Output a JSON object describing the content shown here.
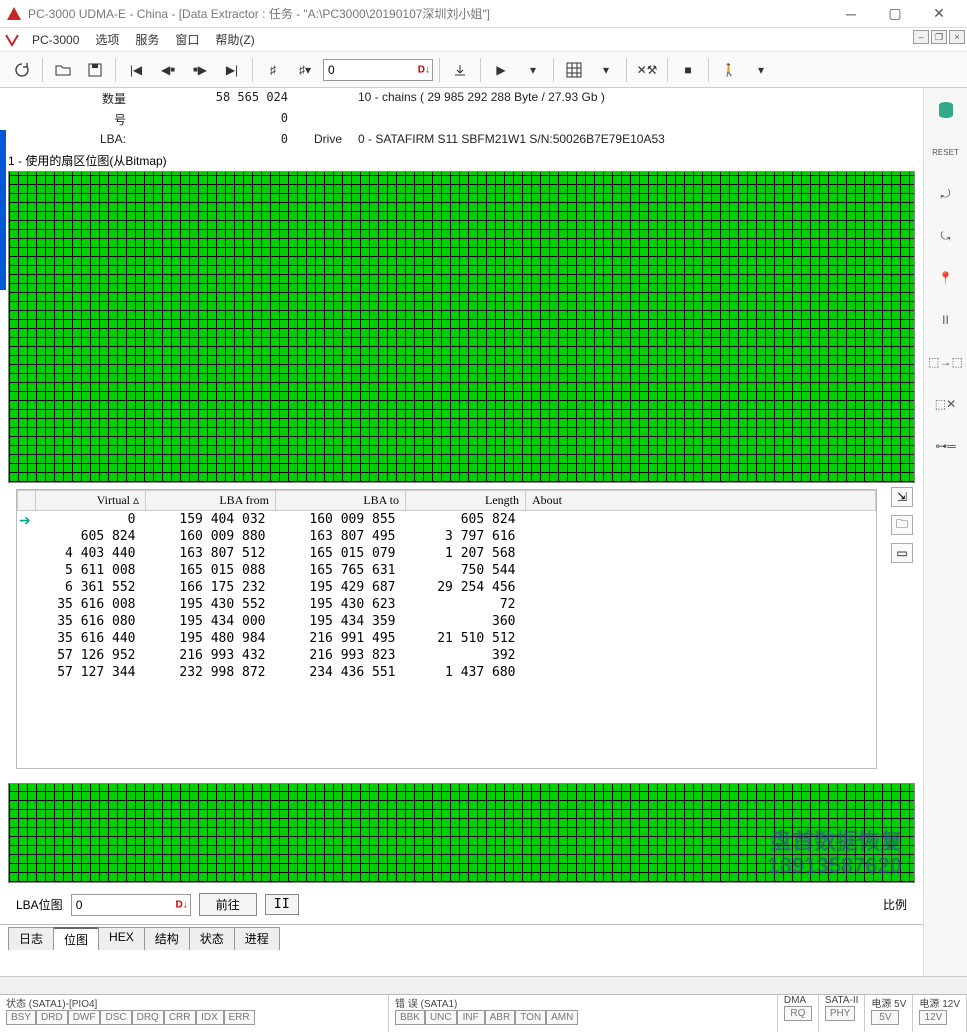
{
  "window": {
    "title": "PC-3000 UDMA-E - China - [Data Extractor : 任务 - \"A:\\PC3000\\20190107深圳刘小姐\"]",
    "app": "PC-3000"
  },
  "menu": {
    "items": [
      "选项",
      "服务",
      "窗口",
      "帮助(Z)"
    ]
  },
  "toolbar_input": {
    "value": "0"
  },
  "info": {
    "qty_label": "数量",
    "qty_value": "58 565 024",
    "qty_extra": "10 - chains   ( 29 985 292 288 Byte /   27.93 Gb )",
    "num_label": "号",
    "num_value": "0",
    "lba_label": "LBA:",
    "lba_value": "0",
    "drive_label": "Drive",
    "drive_value": "0 - SATAFIRM   S11 SBFM21W1 S/N:50026B7E79E10A53"
  },
  "bitmap_panel_label": "1 - 使用的扇区位图(从Bitmap)",
  "table": {
    "headers": {
      "virtual": "Virtual ▵",
      "lba_from": "LBA from",
      "lba_to": "LBA to",
      "length": "Length",
      "about": "About"
    },
    "rows": [
      {
        "virtual": "0",
        "from": "159 404 032",
        "to": "160 009 855",
        "len": "605 824",
        "about": ""
      },
      {
        "virtual": "605 824",
        "from": "160 009 880",
        "to": "163 807 495",
        "len": "3 797 616",
        "about": ""
      },
      {
        "virtual": "4 403 440",
        "from": "163 807 512",
        "to": "165 015 079",
        "len": "1 207 568",
        "about": ""
      },
      {
        "virtual": "5 611 008",
        "from": "165 015 088",
        "to": "165 765 631",
        "len": "750 544",
        "about": ""
      },
      {
        "virtual": "6 361 552",
        "from": "166 175 232",
        "to": "195 429 687",
        "len": "29 254 456",
        "about": ""
      },
      {
        "virtual": "35 616 008",
        "from": "195 430 552",
        "to": "195 430 623",
        "len": "72",
        "about": ""
      },
      {
        "virtual": "35 616 080",
        "from": "195 434 000",
        "to": "195 434 359",
        "len": "360",
        "about": ""
      },
      {
        "virtual": "35 616 440",
        "from": "195 480 984",
        "to": "216 991 495",
        "len": "21 510 512",
        "about": ""
      },
      {
        "virtual": "57 126 952",
        "from": "216 993 432",
        "to": "216 993 823",
        "len": "392",
        "about": ""
      },
      {
        "virtual": "57 127 344",
        "from": "232 998 872",
        "to": "234 436 551",
        "len": "1 437 680",
        "about": ""
      }
    ]
  },
  "lba": {
    "label": "LBA位图",
    "value": "0",
    "go": "前往",
    "ratio": "比例"
  },
  "tabs": {
    "items": [
      "日志",
      "位图",
      "HEX",
      "结构",
      "状态",
      "进程"
    ],
    "active": 1
  },
  "bottom": {
    "status": {
      "title": "状态 (SATA1)-[PIO4]",
      "flags": [
        "BSY",
        "DRD",
        "DWF",
        "DSC",
        "DRQ",
        "CRR",
        "IDX",
        "ERR"
      ]
    },
    "error": {
      "title": "错 误 (SATA1)",
      "flags": [
        "BBK",
        "UNC",
        "INF",
        "ABR",
        "TON",
        "AMN"
      ]
    },
    "dma": {
      "title": "DMA",
      "flags": [
        "RQ"
      ]
    },
    "sata2": {
      "title": "SATA-II",
      "flags": [
        "PHY"
      ]
    },
    "pw5": {
      "title": "电源 5V",
      "flags": [
        "5V"
      ]
    },
    "pw12": {
      "title": "电源 12V",
      "flags": [
        "12V"
      ]
    }
  },
  "watermark": {
    "line1": "盘首数据恢复",
    "line2": "18913587620"
  }
}
